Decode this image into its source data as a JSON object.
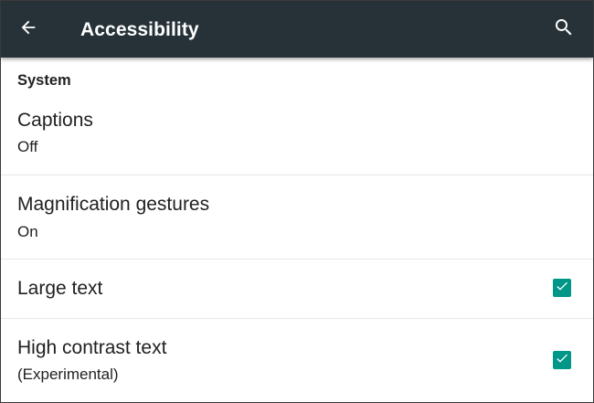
{
  "app_bar": {
    "title": "Accessibility",
    "back_icon": "arrow-back-icon",
    "search_icon": "search-icon",
    "background_color": "#263238"
  },
  "section": {
    "header": "System"
  },
  "preferences": [
    {
      "title": "Captions",
      "summary": "Off"
    },
    {
      "title": "Magnification gestures",
      "summary": "On"
    },
    {
      "title": "Large text",
      "checked": true
    },
    {
      "title": "High contrast text",
      "summary": "(Experimental)",
      "checked": true
    }
  ],
  "accent_color": "#009688"
}
